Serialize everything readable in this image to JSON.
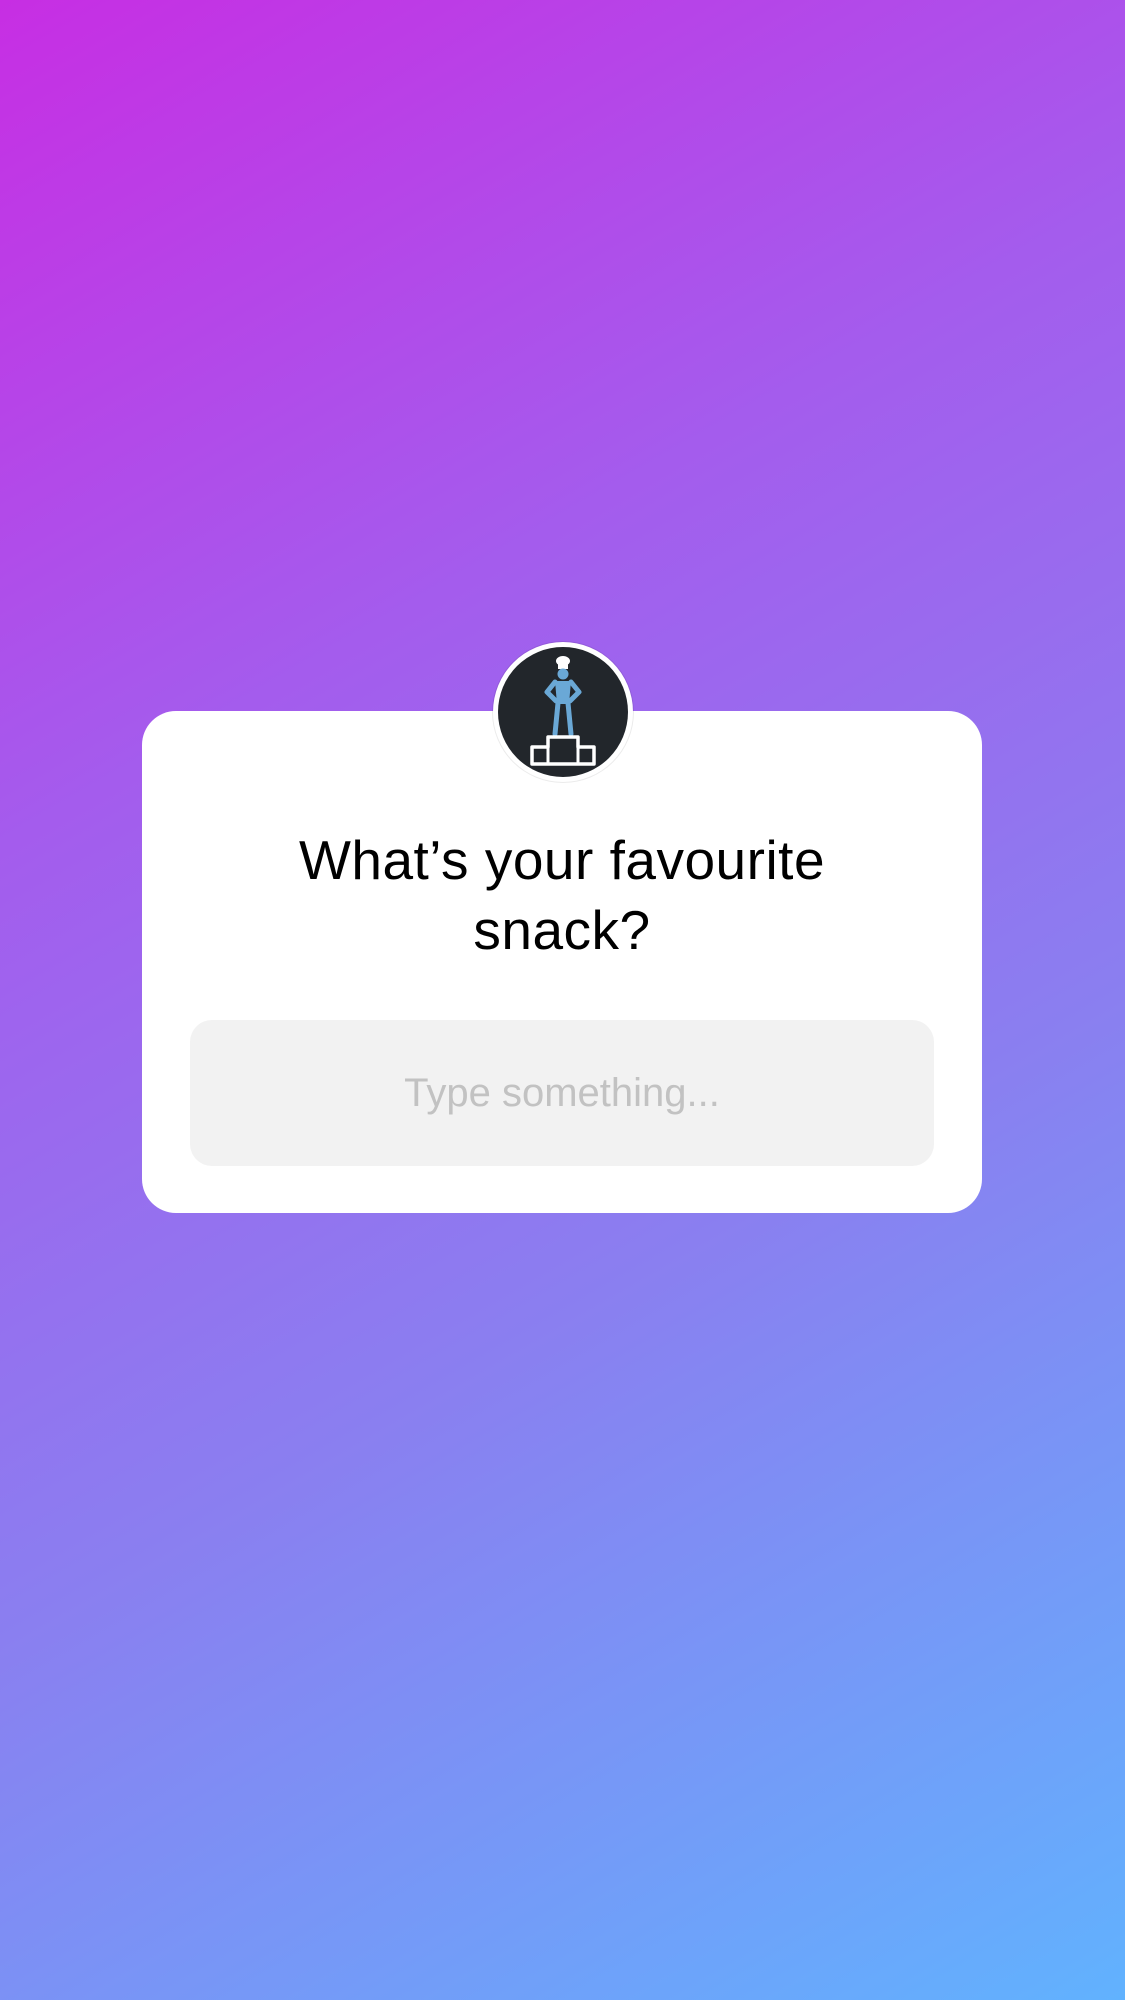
{
  "question_sticker": {
    "question": "What’s your favourite\nsnack?",
    "answer_value": "",
    "answer_placeholder": "Type something..."
  },
  "avatar": {
    "icon": "chef-on-podium-icon",
    "background_color": "#22262b",
    "figure_color": "#6aa8d6"
  },
  "theme": {
    "background_gradient": [
      "#c72ee3",
      "#a45ced",
      "#8a7ff0",
      "#61b2fe"
    ],
    "card_color": "#ffffff",
    "field_color": "#f2f2f2",
    "placeholder_color": "#c2c2c2"
  }
}
